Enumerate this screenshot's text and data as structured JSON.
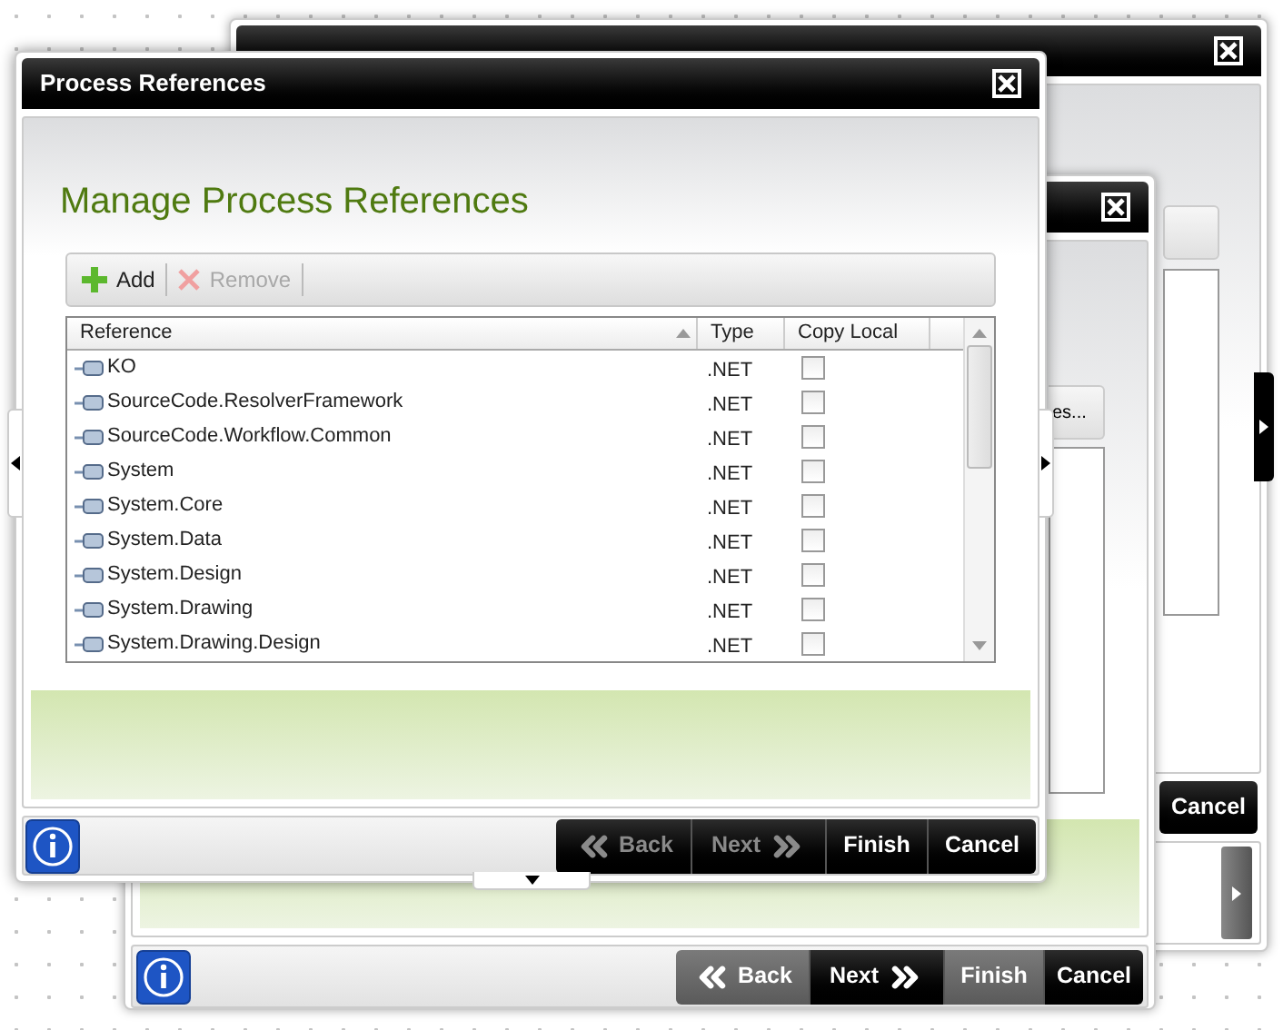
{
  "back_window": {
    "cancel_button": "Cancel"
  },
  "middle_window": {
    "side_button": "es...",
    "nav_buttons": [
      {
        "label": "Back",
        "kind": "back",
        "disabled": false,
        "highlighted": false
      },
      {
        "label": "Next",
        "kind": "next",
        "disabled": false,
        "highlighted": true
      },
      {
        "label": "Finish",
        "kind": "plain",
        "disabled": false,
        "highlighted": false
      },
      {
        "label": "Cancel",
        "kind": "plain",
        "disabled": false,
        "highlighted": true
      }
    ]
  },
  "front_window": {
    "title": "Process References",
    "heading": "Manage Process References",
    "toolbar": [
      {
        "label": "Add",
        "kind": "add",
        "disabled": false
      },
      {
        "label": "Remove",
        "kind": "remove",
        "disabled": true
      }
    ],
    "table": {
      "columns": [
        {
          "label": "Reference",
          "sorted": true
        },
        {
          "label": "Type",
          "sorted": false
        },
        {
          "label": "Copy Local",
          "sorted": false
        }
      ],
      "rows": [
        {
          "reference": "KO",
          "type": ".NET",
          "copy_local": false
        },
        {
          "reference": "SourceCode.ResolverFramework",
          "type": ".NET",
          "copy_local": false
        },
        {
          "reference": "SourceCode.Workflow.Common",
          "type": ".NET",
          "copy_local": false
        },
        {
          "reference": "System",
          "type": ".NET",
          "copy_local": false
        },
        {
          "reference": "System.Core",
          "type": ".NET",
          "copy_local": false
        },
        {
          "reference": "System.Data",
          "type": ".NET",
          "copy_local": false
        },
        {
          "reference": "System.Design",
          "type": ".NET",
          "copy_local": false
        },
        {
          "reference": "System.Drawing",
          "type": ".NET",
          "copy_local": false
        },
        {
          "reference": "System.Drawing.Design",
          "type": ".NET",
          "copy_local": false
        }
      ]
    },
    "nav_buttons": [
      {
        "label": "Back",
        "kind": "back",
        "disabled": true,
        "highlighted": true
      },
      {
        "label": "Next",
        "kind": "next",
        "disabled": true,
        "highlighted": true
      },
      {
        "label": "Finish",
        "kind": "plain",
        "disabled": false,
        "highlighted": true
      },
      {
        "label": "Cancel",
        "kind": "plain",
        "disabled": false,
        "highlighted": true
      }
    ]
  }
}
